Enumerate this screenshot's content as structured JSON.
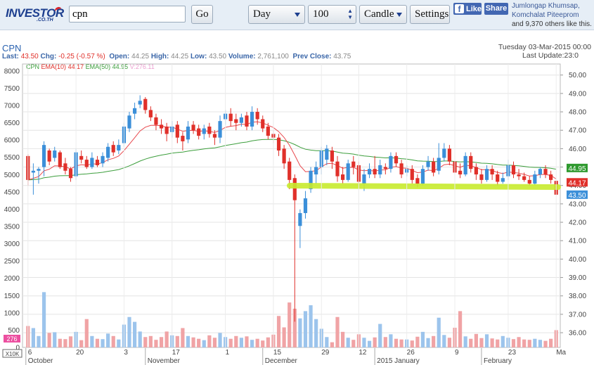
{
  "header": {
    "logo_text": "INVESTOR",
    "logo_sub": ".CO.TH",
    "search_value": "cpn",
    "go_label": "Go",
    "period_value": "Day",
    "count_value": "100",
    "style_value": "Candle",
    "settings_label": "Settings",
    "fb_like_label": "Like",
    "fb_share_label": "Share",
    "fb_names": "Jumlongap Khumsap, Komchalat Piteeprom",
    "fb_rest": "and 9,370 others like this."
  },
  "quote": {
    "symbol": "CPN",
    "last_label": "Last:",
    "last": "43.50",
    "chg_label": "Chg:",
    "chg": "-0.25 (-0.57 %)",
    "open_label": "Open:",
    "open": "44.25",
    "high_label": "High:",
    "high": "44.25",
    "low_label": "Low:",
    "low": "43.50",
    "volume_label": "Volume:",
    "volume": "2,761,100",
    "prev_label": "Prev Close:",
    "prev": "43.75",
    "date": "Tuesday 03-Mar-2015 00:00",
    "last_update": "Last Update:23:0"
  },
  "colors": {
    "up": "#3b8fd9",
    "down": "#e0302a",
    "ema10": "#e8484d",
    "ema50": "#3c9e3c",
    "volume_label": "#ec4fa0",
    "highlight": "#c8ec2e"
  },
  "chart_data": {
    "type": "candlestick",
    "legend": {
      "symbol": "CPN",
      "ema10_label": "EMA(10)",
      "ema10_value": "44.17",
      "ema50_label": "EMA(50)",
      "ema50_value": "44.95",
      "volume_label": "V:",
      "volume_value": "276.11"
    },
    "price_axis": {
      "ylim": [
        35.2,
        50.6
      ],
      "ticks": [
        "50.00",
        "49.00",
        "48.00",
        "47.00",
        "46.00",
        "45.00",
        "44.00",
        "43.00",
        "42.00",
        "41.00",
        "40.00",
        "39.00",
        "38.00",
        "37.00",
        "36.00"
      ]
    },
    "volume_axis": {
      "ylim": [
        0,
        8200
      ],
      "ticks": [
        "8000",
        "7500",
        "7000",
        "6500",
        "6000",
        "5500",
        "5000",
        "4500",
        "4000",
        "3500",
        "3000",
        "2500",
        "2000",
        "1500",
        "1000",
        "500",
        "0"
      ],
      "unit": "X10K",
      "current_marker": "276"
    },
    "x_axis": {
      "day_labels": [
        "6",
        "20",
        "3",
        "17",
        "1",
        "15",
        "29",
        "12",
        "26",
        "9",
        "23",
        "Ma"
      ],
      "month_labels": [
        "October",
        "November",
        "December",
        "2015 January",
        "February"
      ]
    },
    "price_tags": [
      {
        "name": "ema50",
        "value": "44.95"
      },
      {
        "name": "ema10",
        "value": "44.17"
      },
      {
        "name": "last",
        "value": "43.50"
      }
    ],
    "candles": [
      [
        45.6,
        44.3,
        45.7,
        44.0
      ],
      [
        44.7,
        44.8,
        45.2,
        43.5
      ],
      [
        44.8,
        44.9,
        45.0,
        44.1
      ],
      [
        45.0,
        46.2,
        46.4,
        44.5
      ],
      [
        45.9,
        45.3,
        46.0,
        45.1
      ],
      [
        45.5,
        45.9,
        46.1,
        45.3
      ],
      [
        45.8,
        45.0,
        45.9,
        44.9
      ],
      [
        45.2,
        44.8,
        45.5,
        44.6
      ],
      [
        44.9,
        44.4,
        45.0,
        44.2
      ],
      [
        44.5,
        45.8,
        46.0,
        44.3
      ],
      [
        45.6,
        45.4,
        45.9,
        45.2
      ],
      [
        45.4,
        45.0,
        45.6,
        44.9
      ],
      [
        45.0,
        45.5,
        45.8,
        44.9
      ],
      [
        45.4,
        45.1,
        45.6,
        45.0
      ],
      [
        45.2,
        45.6,
        45.8,
        45.0
      ],
      [
        45.5,
        46.1,
        46.3,
        45.3
      ],
      [
        46.2,
        45.8,
        46.4,
        45.6
      ],
      [
        45.9,
        46.2,
        46.5,
        45.7
      ],
      [
        46.3,
        47.2,
        47.4,
        46.1
      ],
      [
        47.1,
        47.8,
        48.0,
        46.9
      ],
      [
        47.9,
        48.2,
        48.5,
        47.6
      ],
      [
        48.4,
        48.6,
        48.9,
        48.2
      ],
      [
        48.7,
        48.1,
        48.8,
        47.9
      ],
      [
        48.1,
        47.7,
        48.3,
        47.5
      ],
      [
        47.7,
        47.3,
        47.9,
        47.0
      ],
      [
        47.3,
        47.1,
        47.6,
        46.8
      ],
      [
        47.2,
        46.8,
        47.4,
        46.4
      ],
      [
        46.9,
        47.2,
        47.5,
        46.6
      ],
      [
        47.3,
        46.6,
        47.5,
        46.3
      ],
      [
        46.7,
        46.4,
        46.9,
        45.9
      ],
      [
        46.5,
        47.2,
        47.5,
        46.3
      ],
      [
        47.3,
        47.0,
        47.5,
        46.8
      ],
      [
        47.1,
        46.7,
        47.3,
        46.5
      ],
      [
        46.8,
        47.1,
        47.3,
        46.5
      ],
      [
        47.2,
        46.8,
        47.4,
        46.6
      ],
      [
        46.8,
        46.6,
        47.0,
        46.2
      ],
      [
        46.6,
        47.5,
        47.8,
        46.3
      ],
      [
        47.6,
        47.9,
        48.1,
        47.3
      ],
      [
        47.9,
        47.5,
        48.2,
        47.2
      ],
      [
        47.6,
        47.4,
        47.9,
        47.0
      ],
      [
        47.4,
        47.7,
        47.9,
        47.2
      ],
      [
        47.8,
        47.2,
        48.0,
        47.0
      ],
      [
        47.2,
        48.0,
        48.3,
        47.0
      ],
      [
        48.0,
        47.6,
        48.2,
        47.3
      ],
      [
        47.6,
        47.1,
        47.8,
        46.9
      ],
      [
        47.2,
        46.7,
        47.4,
        46.5
      ],
      [
        46.8,
        46.6,
        47.0,
        46.3
      ],
      [
        46.6,
        45.9,
        46.8,
        45.6
      ],
      [
        46.0,
        45.2,
        46.2,
        44.9
      ],
      [
        45.3,
        44.3,
        45.5,
        43.8
      ],
      [
        44.4,
        43.2,
        44.6,
        36.6
      ],
      [
        41.8,
        42.5,
        42.7,
        40.6
      ],
      [
        42.5,
        43.3,
        43.7,
        42.2
      ],
      [
        43.8,
        44.8,
        45.0,
        43.6
      ],
      [
        44.6,
        45.0,
        45.3,
        44.1
      ],
      [
        45.0,
        45.9,
        46.1,
        44.6
      ],
      [
        45.4,
        46.0,
        46.2,
        45.1
      ],
      [
        45.9,
        45.3,
        46.1,
        44.9
      ],
      [
        45.3,
        44.5,
        45.6,
        44.2
      ],
      [
        44.6,
        44.3,
        45.0,
        44.1
      ],
      [
        44.3,
        45.2,
        45.4,
        44.2
      ],
      [
        45.3,
        45.0,
        45.6,
        44.6
      ],
      [
        45.1,
        44.2,
        45.3,
        43.9
      ],
      [
        44.1,
        44.6,
        44.9,
        43.7
      ],
      [
        44.6,
        44.9,
        45.2,
        44.4
      ],
      [
        44.9,
        44.6,
        45.6,
        44.4
      ],
      [
        44.6,
        45.1,
        45.4,
        44.4
      ],
      [
        45.0,
        44.9,
        45.2,
        44.6
      ],
      [
        44.9,
        45.6,
        45.8,
        44.7
      ],
      [
        45.6,
        45.2,
        45.8,
        45.0
      ],
      [
        45.2,
        44.6,
        45.4,
        44.4
      ],
      [
        44.7,
        44.9,
        45.1,
        44.5
      ],
      [
        44.9,
        44.3,
        45.1,
        44.1
      ],
      [
        44.4,
        44.1,
        44.6,
        43.9
      ],
      [
        44.1,
        44.9,
        45.1,
        44.0
      ],
      [
        45.0,
        45.3,
        45.6,
        44.8
      ],
      [
        45.3,
        44.7,
        45.5,
        44.5
      ],
      [
        44.8,
        45.5,
        46.3,
        44.6
      ],
      [
        45.5,
        46.0,
        46.3,
        45.3
      ],
      [
        46.0,
        45.3,
        46.2,
        45.1
      ],
      [
        45.3,
        44.7,
        45.6,
        44.5
      ],
      [
        44.8,
        44.6,
        45.2,
        44.4
      ],
      [
        44.6,
        45.6,
        45.8,
        44.5
      ],
      [
        45.6,
        44.9,
        45.8,
        44.7
      ],
      [
        45.0,
        44.6,
        45.2,
        44.3
      ],
      [
        44.6,
        44.3,
        44.9,
        44.1
      ],
      [
        44.3,
        44.9,
        45.1,
        44.2
      ],
      [
        44.9,
        44.6,
        45.1,
        44.3
      ],
      [
        44.6,
        44.2,
        44.8,
        44.0
      ],
      [
        44.2,
        44.4,
        44.7,
        44.1
      ],
      [
        44.5,
        45.1,
        45.4,
        44.3
      ],
      [
        45.1,
        44.6,
        45.3,
        44.4
      ],
      [
        44.6,
        44.5,
        44.9,
        44.3
      ],
      [
        44.5,
        44.3,
        44.7,
        44.2
      ],
      [
        44.3,
        44.1,
        44.5,
        44.0
      ],
      [
        44.1,
        44.6,
        44.8,
        44.0
      ],
      [
        44.6,
        44.9,
        45.0,
        44.4
      ],
      [
        44.9,
        44.6,
        45.1,
        44.4
      ],
      [
        44.6,
        44.3,
        44.8,
        44.1
      ],
      [
        44.25,
        43.5,
        44.25,
        43.5
      ]
    ],
    "volumes": [
      620,
      560,
      330,
      1600,
      420,
      440,
      250,
      240,
      320,
      450,
      210,
      820,
      330,
      250,
      240,
      400,
      330,
      230,
      660,
      880,
      740,
      460,
      300,
      330,
      220,
      300,
      460,
      350,
      330,
      560,
      330,
      290,
      250,
      210,
      350,
      280,
      420,
      300,
      250,
      330,
      280,
      320,
      220,
      250,
      200,
      290,
      370,
      910,
      580,
      1300,
      1120,
      840,
      1050,
      1220,
      820,
      540,
      300,
      150,
      880,
      450,
      280,
      220,
      380,
      280,
      190,
      290,
      680,
      300,
      380,
      250,
      230,
      230,
      200,
      310,
      450,
      270,
      330,
      860,
      360,
      280,
      570,
      1050,
      320,
      250,
      390,
      270,
      380,
      260,
      230,
      330,
      280,
      240,
      300,
      230,
      220,
      250,
      220,
      190,
      250,
      500
    ]
  }
}
